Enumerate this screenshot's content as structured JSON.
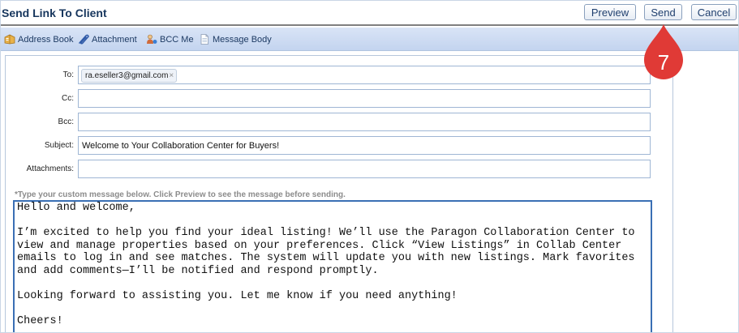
{
  "header": {
    "title": "Send Link To Client",
    "preview_label": "Preview",
    "send_label": "Send",
    "cancel_label": "Cancel"
  },
  "toolbar": {
    "items": [
      {
        "label": "Address Book",
        "icon": "address-book-icon"
      },
      {
        "label": "Attachment",
        "icon": "paperclip-icon"
      },
      {
        "label": "BCC Me",
        "icon": "bcc-person-icon"
      },
      {
        "label": "Message Body",
        "icon": "document-icon"
      }
    ]
  },
  "form": {
    "to_label": "To:",
    "to_token": "ra.eseller3@gmail.com",
    "to_token_remove": "×",
    "cc_label": "Cc:",
    "cc_value": "",
    "bcc_label": "Bcc:",
    "bcc_value": "",
    "subject_label": "Subject:",
    "subject_value": "Welcome to Your Collaboration Center for Buyers!",
    "attachments_label": "Attachments:",
    "attachments_value": "",
    "instruction": "*Type your custom message below. Click Preview to see the message before sending.",
    "message": "Hello and welcome,\n\nI’m excited to help you find your ideal listing! We’ll use the Paragon Collaboration Center to view and manage properties based on your preferences. Click “View Listings” in Collab Center emails to log in and see matches. The system will update you with new listings. Mark favorites and add comments—I’ll be notified and respond promptly.\n\nLooking forward to assisting you. Let me know if you need anything!\n\nCheers!"
  },
  "annotation": {
    "step_number": "7",
    "color": "#e03a36"
  },
  "colors": {
    "title": "#17365d",
    "toolbar_bg": "#c9d8f1",
    "message_border": "#3a6fb4"
  }
}
